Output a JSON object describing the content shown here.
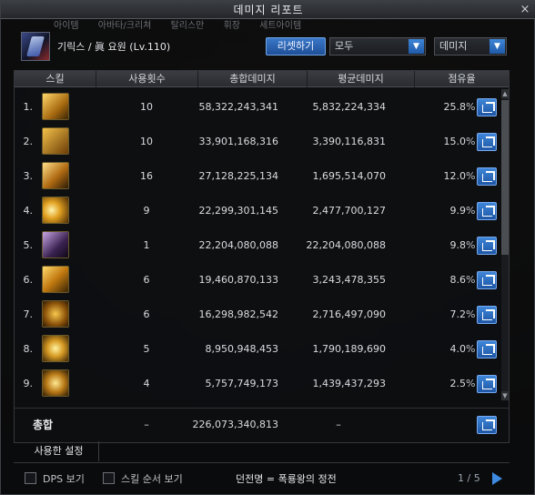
{
  "window": {
    "title": "데미지 리포트",
    "close_icon": "×"
  },
  "ghost_tabs": [
    "아이템",
    "아바타/크리쳐",
    "탈리스만",
    "휘장",
    "세트아이템"
  ],
  "character": {
    "name": "기릭스 / 眞 요원 (Lv.110)"
  },
  "controls": {
    "reset_label": "리셋하기",
    "filter_value": "모두",
    "sort_value": "데미지",
    "arrow": "▼"
  },
  "table": {
    "columns": [
      "스킬",
      "사용횟수",
      "총합데미지",
      "평균데미지",
      "점유율"
    ],
    "rows": [
      {
        "idx": "1.",
        "count": "10",
        "total": "58,322,243,341",
        "avg": "5,832,224,334",
        "pct": "25.8",
        "pct_sign": "%"
      },
      {
        "idx": "2.",
        "count": "10",
        "total": "33,901,168,316",
        "avg": "3,390,116,831",
        "pct": "15.0",
        "pct_sign": "%"
      },
      {
        "idx": "3.",
        "count": "16",
        "total": "27,128,225,134",
        "avg": "1,695,514,070",
        "pct": "12.0",
        "pct_sign": "%"
      },
      {
        "idx": "4.",
        "count": "9",
        "total": "22,299,301,145",
        "avg": "2,477,700,127",
        "pct": "9.9",
        "pct_sign": "%"
      },
      {
        "idx": "5.",
        "count": "1",
        "total": "22,204,080,088",
        "avg": "22,204,080,088",
        "pct": "9.8",
        "pct_sign": "%"
      },
      {
        "idx": "6.",
        "count": "6",
        "total": "19,460,870,133",
        "avg": "3,243,478,355",
        "pct": "8.6",
        "pct_sign": "%"
      },
      {
        "idx": "7.",
        "count": "6",
        "total": "16,298,982,542",
        "avg": "2,716,497,090",
        "pct": "7.2",
        "pct_sign": "%"
      },
      {
        "idx": "8.",
        "count": "5",
        "total": "8,950,948,453",
        "avg": "1,790,189,690",
        "pct": "4.0",
        "pct_sign": "%"
      },
      {
        "idx": "9.",
        "count": "4",
        "total": "5,757,749,173",
        "avg": "1,439,437,293",
        "pct": "2.5",
        "pct_sign": "%"
      }
    ],
    "total": {
      "label": "총합",
      "count": "–",
      "total": "226,073,340,813",
      "avg": "–"
    }
  },
  "settings_tab": "사용한 설정",
  "footer": {
    "dps_label": "DPS 보기",
    "order_label": "스킬 순서 보기",
    "dungeon": "던전명 = 폭룡왕의 정전",
    "pager": "1 / 5"
  },
  "colors": {
    "accent": "#3a78c9",
    "bg": "#0b0c0e"
  },
  "icons": [
    "skill-icon-1",
    "skill-icon-2",
    "skill-icon-3",
    "skill-icon-4",
    "skill-icon-5",
    "skill-icon-6",
    "skill-icon-7",
    "skill-icon-8",
    "skill-icon-9"
  ]
}
